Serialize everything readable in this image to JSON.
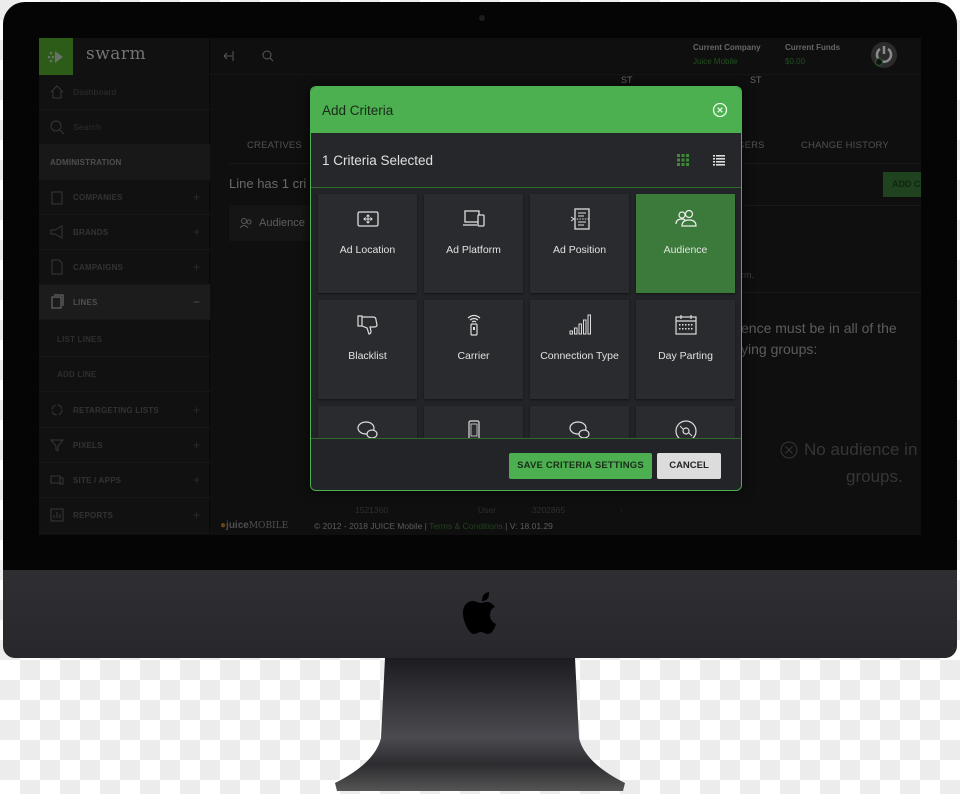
{
  "app": {
    "brand_name": "swarm",
    "logo_icon": "swarm-logo-icon"
  },
  "sidebar": {
    "items": [
      {
        "label": "Dashboard",
        "icon": "home-icon"
      },
      {
        "label": "Search",
        "icon": "search-icon"
      },
      {
        "label": "ADMINISTRATION"
      },
      {
        "label": "COMPANIES",
        "icon": "building-icon",
        "toggle": "+"
      },
      {
        "label": "BRANDS",
        "icon": "megaphone-icon",
        "toggle": "+"
      },
      {
        "label": "CAMPAIGNS",
        "icon": "document-icon",
        "toggle": "+"
      },
      {
        "label": "LINES",
        "icon": "stack-icon",
        "toggle": "−"
      },
      {
        "label": "LIST LINES"
      },
      {
        "label": "ADD LINE"
      },
      {
        "label": "RETARGETING LISTS",
        "icon": "cycle-icon",
        "toggle": "+"
      },
      {
        "label": "PIXELS",
        "icon": "funnel-icon",
        "toggle": "+"
      },
      {
        "label": "SITE / APPS",
        "icon": "devices-icon",
        "toggle": "+"
      },
      {
        "label": "REPORTS",
        "icon": "report-icon",
        "toggle": "+"
      }
    ]
  },
  "topbar": {
    "current_company_label": "Current Company",
    "current_company_value": "Juice Mobile",
    "current_funds_label": "Current Funds",
    "current_funds_value": "$0.00",
    "col_fragment_1": "ST",
    "col_fragment_2": "ST"
  },
  "main": {
    "tabs": [
      "CREATIVES",
      "GERS",
      "CHANGE HISTORY"
    ],
    "criteria_text": "Line has 1 cri",
    "audience_chip": "Audience",
    "add_button": "ADD C",
    "note_fragment": "rm.",
    "audience_rule_line1": "ence must be in all of the",
    "audience_rule_line2": "ying groups:",
    "no_audience_line1": "No audience in",
    "no_audience_line2": "groups.",
    "table_ghost_row": [
      "1521360",
      "User",
      "3202865",
      "-"
    ]
  },
  "modal": {
    "title": "Add Criteria",
    "selected_text": "1 Criteria Selected",
    "tiles": [
      {
        "label": "Ad Location",
        "icon": "ad-location-icon",
        "selected": false
      },
      {
        "label": "Ad Platform",
        "icon": "ad-platform-icon",
        "selected": false
      },
      {
        "label": "Ad Position",
        "icon": "ad-position-icon",
        "selected": false
      },
      {
        "label": "Audience",
        "icon": "audience-icon",
        "selected": true
      },
      {
        "label": "Blacklist",
        "icon": "thumbs-down-icon",
        "selected": false
      },
      {
        "label": "Carrier",
        "icon": "carrier-icon",
        "selected": false
      },
      {
        "label": "Connection Type",
        "icon": "signal-bars-icon",
        "selected": false
      },
      {
        "label": "Day Parting",
        "icon": "calendar-icon",
        "selected": false
      },
      {
        "label": "",
        "icon": "chat-bubbles-icon",
        "selected": false
      },
      {
        "label": "",
        "icon": "phone-icon",
        "selected": false
      },
      {
        "label": "",
        "icon": "chat-bubbles-icon",
        "selected": false
      },
      {
        "label": "",
        "icon": "disc-icon",
        "selected": false
      }
    ],
    "save_label": "SAVE CRITERIA SETTINGS",
    "cancel_label": "CANCEL"
  },
  "footer": {
    "logo_text": "juice",
    "logo_suffix": "MOBILE",
    "copyright": "© 2012 - 2018 JUICE Mobile | ",
    "terms_link": "Terms & Conditions",
    "version": " | V: 18.01.29"
  },
  "colors": {
    "accent_green": "#4caf50",
    "selected_tile": "#3b7a3a",
    "screen_bg": "#141414"
  }
}
